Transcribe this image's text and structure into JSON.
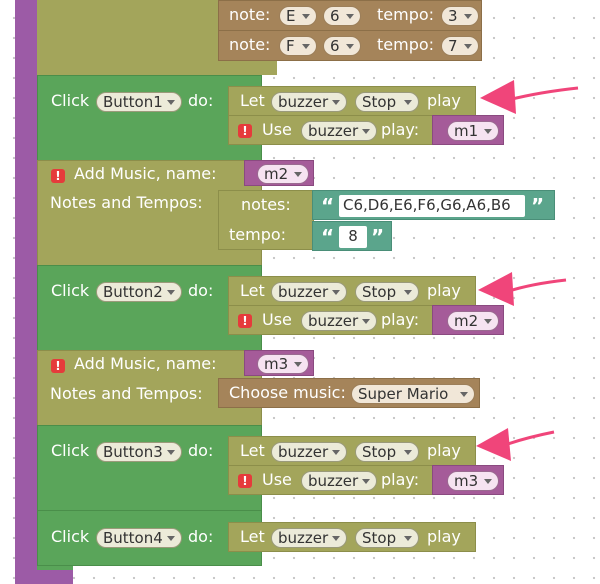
{
  "colors": {
    "event": "#5aa55a",
    "let": "#a3a55b",
    "music": "#a5845a",
    "list": "#5ba58c",
    "var": "#a55b99",
    "frame": "#9c5ba6",
    "arrow": "#f0457a"
  },
  "top_notes": [
    {
      "note_label": "note:",
      "note": "E",
      "octave": "6",
      "tempo_label": "tempo:",
      "tempo": "3"
    },
    {
      "note_label": "note:",
      "note": "F",
      "octave": "6",
      "tempo_label": "tempo:",
      "tempo": "7"
    }
  ],
  "events": [
    {
      "click": "Click",
      "button": "Button1",
      "do": "do:",
      "let": "Let",
      "device": "buzzer",
      "action": "Stop",
      "play": "play",
      "use": "Use",
      "device2": "buzzer",
      "play2": "play:",
      "music": "m1"
    },
    {
      "click": "Click",
      "button": "Button2",
      "do": "do:",
      "let": "Let",
      "device": "buzzer",
      "action": "Stop",
      "play": "play",
      "use": "Use",
      "device2": "buzzer",
      "play2": "play:",
      "music": "m2"
    },
    {
      "click": "Click",
      "button": "Button3",
      "do": "do:",
      "let": "Let",
      "device": "buzzer",
      "action": "Stop",
      "play": "play",
      "use": "Use",
      "device2": "buzzer",
      "play2": "play:",
      "music": "m3"
    },
    {
      "click": "Click",
      "button": "Button4",
      "do": "do:",
      "let": "Let",
      "device": "buzzer",
      "action": "Stop",
      "play": "play"
    }
  ],
  "add_music": [
    {
      "label": "Add Music, name:",
      "name": "m2",
      "notes_tempos": "Notes and Tempos:",
      "notes_label": "notes:",
      "notes": "C6,D6,E6,F6,G6,A6,B6",
      "tempo_label": "tempo:",
      "tempo": "8"
    },
    {
      "label": "Add Music, name:",
      "name": "m3",
      "notes_tempos": "Notes and Tempos:",
      "choose_label": "Choose music:",
      "choice": "Super Mario"
    }
  ],
  "quote_open": "“",
  "quote_close": "”",
  "warning_glyph": "!"
}
